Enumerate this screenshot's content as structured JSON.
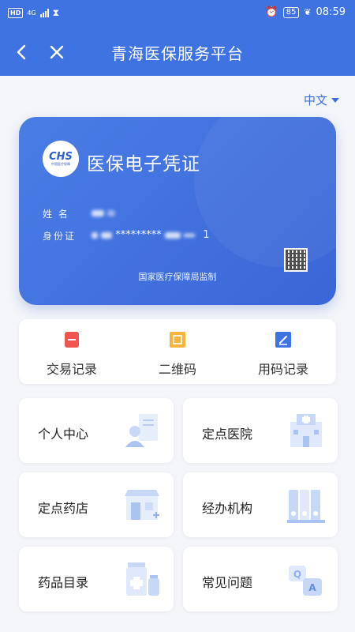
{
  "statusbar": {
    "network": "4G",
    "battery": "85",
    "time": "08:59"
  },
  "navbar": {
    "title": "青海医保服务平台"
  },
  "language": {
    "label": "中文"
  },
  "card": {
    "logo_text": "CHS",
    "logo_sub": "中国医疗保障",
    "title": "医保电子凭证",
    "name_label": "姓 名",
    "id_label": "身份证",
    "id_masked": "*********",
    "id_tail": "1",
    "footer": "国家医疗保障局监制"
  },
  "quick_actions": [
    {
      "label": "交易记录",
      "icon": "record-icon",
      "color": "#f0554f"
    },
    {
      "label": "二维码",
      "icon": "qrcode-icon",
      "color": "#f5b53d"
    },
    {
      "label": "用码记录",
      "icon": "edit-icon",
      "color": "#3f73e2"
    }
  ],
  "tiles": [
    {
      "label": "个人中心",
      "icon": "person-icon"
    },
    {
      "label": "定点医院",
      "icon": "hospital-icon"
    },
    {
      "label": "定点药店",
      "icon": "pharmacy-icon"
    },
    {
      "label": "经办机构",
      "icon": "binders-icon"
    },
    {
      "label": "药品目录",
      "icon": "medicine-icon"
    },
    {
      "label": "常见问题",
      "icon": "qa-icon"
    }
  ],
  "colors": {
    "primary": "#3f73e2",
    "background": "#f3f5f9"
  }
}
